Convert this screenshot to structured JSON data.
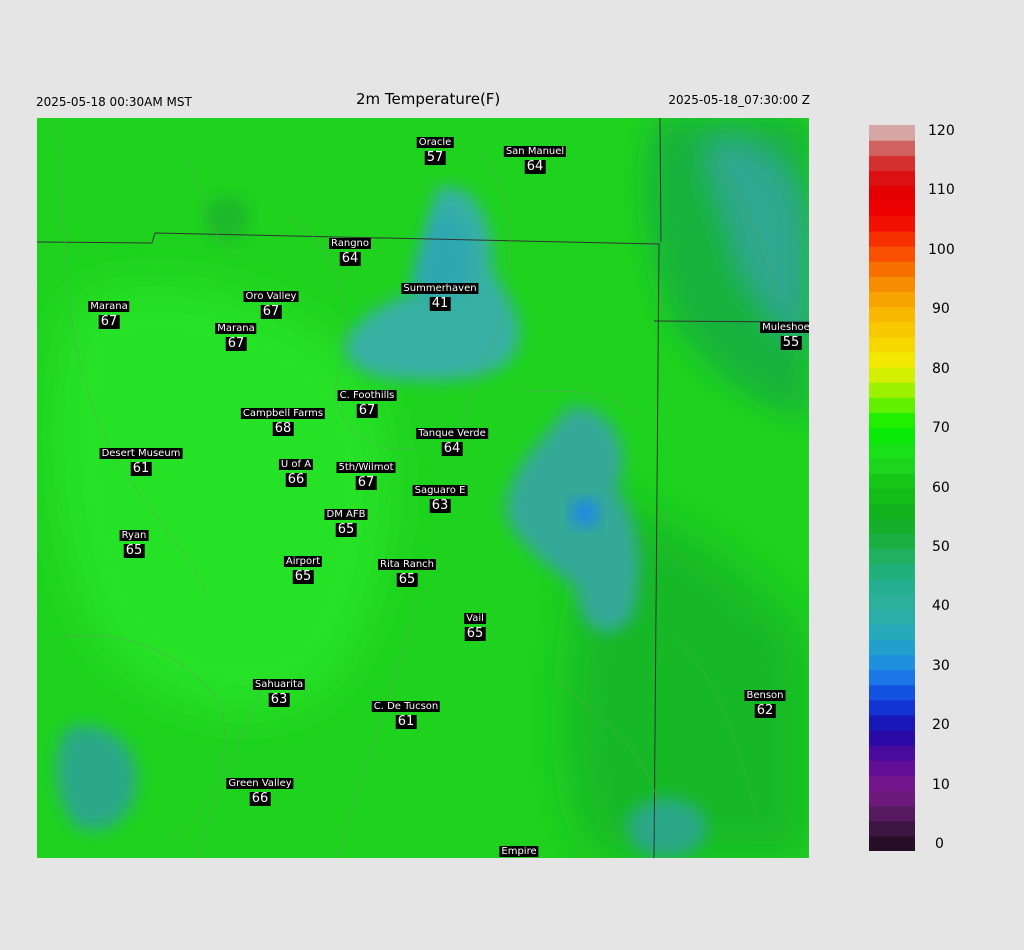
{
  "header": {
    "local_time": "2025-05-18 00:30AM MST",
    "title": "2m Temperature(F)",
    "utc_time": "2025-05-18_07:30:00 Z"
  },
  "stations": [
    {
      "name": "Oracle",
      "value": "57"
    },
    {
      "name": "San Manuel",
      "value": "64"
    },
    {
      "name": "Rangno",
      "value": "64"
    },
    {
      "name": "Summerhaven",
      "value": "41"
    },
    {
      "name": "Marana",
      "value": "67"
    },
    {
      "name": "Oro Valley",
      "value": "67"
    },
    {
      "name": "Marana",
      "value": "67"
    },
    {
      "name": "Muleshoe R",
      "value": "55"
    },
    {
      "name": "C. Foothills",
      "value": "67"
    },
    {
      "name": "Campbell Farms",
      "value": "68"
    },
    {
      "name": "Tanque Verde",
      "value": "64"
    },
    {
      "name": "Desert Museum",
      "value": "61"
    },
    {
      "name": "U of A",
      "value": "66"
    },
    {
      "name": "5th/Wilmot",
      "value": "67"
    },
    {
      "name": "Saguaro E",
      "value": "63"
    },
    {
      "name": "DM AFB",
      "value": "65"
    },
    {
      "name": "Ryan",
      "value": "65"
    },
    {
      "name": "Airport",
      "value": "65"
    },
    {
      "name": "Rita Ranch",
      "value": "65"
    },
    {
      "name": "Vail",
      "value": "65"
    },
    {
      "name": "Sahuarita",
      "value": "63"
    },
    {
      "name": "C. De Tucson",
      "value": "61"
    },
    {
      "name": "Benson",
      "value": "62"
    },
    {
      "name": "Green Valley",
      "value": "66"
    },
    {
      "name": "Empire",
      "value": ""
    }
  ],
  "colorbar": {
    "ticks": [
      "120",
      "110",
      "100",
      "90",
      "80",
      "70",
      "60",
      "50",
      "40",
      "30",
      "20",
      "10",
      "0"
    ],
    "min": 0,
    "max": 120,
    "stops": [
      {
        "v": 0,
        "color": "#1a0a1a"
      },
      {
        "v": 5,
        "color": "#4a1a50"
      },
      {
        "v": 10,
        "color": "#7a1a8a"
      },
      {
        "v": 15,
        "color": "#5a0a9a"
      },
      {
        "v": 20,
        "color": "#1a0aaa"
      },
      {
        "v": 25,
        "color": "#1040e0"
      },
      {
        "v": 30,
        "color": "#1e88e8"
      },
      {
        "v": 35,
        "color": "#20a8c0"
      },
      {
        "v": 40,
        "color": "#30b0a0"
      },
      {
        "v": 45,
        "color": "#20b08a"
      },
      {
        "v": 50,
        "color": "#20b050"
      },
      {
        "v": 55,
        "color": "#10b020"
      },
      {
        "v": 60,
        "color": "#14c014"
      },
      {
        "v": 65,
        "color": "#20dc20"
      },
      {
        "v": 70,
        "color": "#00f000"
      },
      {
        "v": 75,
        "color": "#80f000"
      },
      {
        "v": 80,
        "color": "#f0f000"
      },
      {
        "v": 85,
        "color": "#f8d000"
      },
      {
        "v": 90,
        "color": "#f8b000"
      },
      {
        "v": 95,
        "color": "#f88000"
      },
      {
        "v": 100,
        "color": "#f84000"
      },
      {
        "v": 105,
        "color": "#f00000"
      },
      {
        "v": 110,
        "color": "#e00000"
      },
      {
        "v": 115,
        "color": "#d04040"
      },
      {
        "v": 120,
        "color": "#d8c8c8"
      }
    ]
  },
  "colors": {
    "background": "#e5e5e5",
    "field_base": "#1ed21e",
    "field_cool": "#3ab8a8",
    "field_cold": "#1e88e8",
    "boundary": "#333333"
  }
}
